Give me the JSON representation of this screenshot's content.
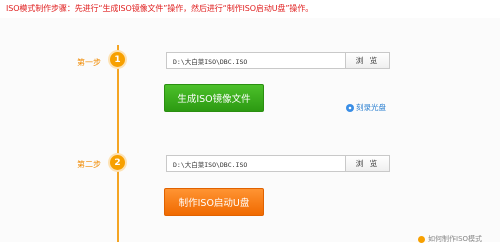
{
  "instruction": "ISO模式制作步骤：先进行“生成ISO镜像文件”操作，然后进行“制作ISO启动U盘”操作。",
  "step1": {
    "label": "第一步",
    "number": "1",
    "path_value": "D:\\大白菜ISO\\DBC.ISO",
    "browse_label": "浏 览",
    "action_label": "生成ISO镜像文件",
    "burn_link": "刻录光盘"
  },
  "step2": {
    "label": "第二步",
    "number": "2",
    "path_value": "D:\\大白菜ISO\\DBC.ISO",
    "browse_label": "浏 览",
    "action_label": "制作ISO启动U盘"
  },
  "bottom_hint": "如何制作ISO模式",
  "icons": {
    "step_badge": "step-number-badge",
    "burn_disc": "disc-icon",
    "hint": "info-icon"
  },
  "colors": {
    "instruction": "#e02020",
    "step_accent": "#f7a000",
    "generate_button": "#3aad1c",
    "usb_button": "#f57a10",
    "link": "#2a7fd0"
  }
}
